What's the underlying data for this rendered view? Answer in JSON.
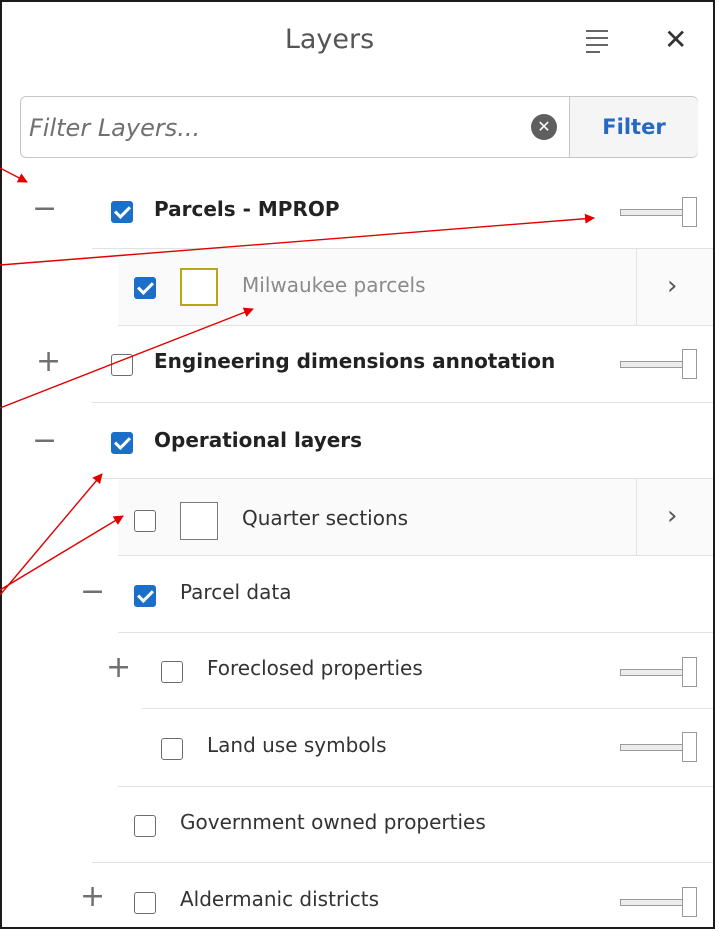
{
  "header": {
    "title": "Layers",
    "menu_icon": "list-options-icon",
    "close_icon": "close-icon",
    "close_glyph": "✕"
  },
  "filter": {
    "placeholder": "Filter Layers...",
    "value": "",
    "clear_icon": "clear-circle-icon",
    "button_label": "Filter"
  },
  "colors": {
    "accent": "#2569c3",
    "checkbox": "#1b6fc9",
    "annotation_arrow": "#e00000",
    "swatch_olive": "#b7a712"
  },
  "layers": [
    {
      "id": "parcels_mprop",
      "label": "Parcels - MPROP",
      "expander": "−",
      "checked": true,
      "bold": true,
      "slider": true
    },
    {
      "id": "milwaukee_parcels",
      "label": "Milwaukee parcels",
      "checked": true,
      "swatch": "olive",
      "greyed": true,
      "chevron": "›"
    },
    {
      "id": "engineering",
      "label": "Engineering dimensions annotation",
      "expander": "+",
      "checked": false,
      "bold": true,
      "slider": true
    },
    {
      "id": "operational",
      "label": "Operational layers",
      "expander": "−",
      "checked": true,
      "bold": true
    },
    {
      "id": "quarter_sections",
      "label": "Quarter sections",
      "checked": false,
      "swatch": "plain",
      "chevron": "›"
    },
    {
      "id": "parcel_data",
      "label": "Parcel data",
      "expander": "−",
      "checked": true
    },
    {
      "id": "foreclosed",
      "label": "Foreclosed properties",
      "expander": "+",
      "checked": false,
      "slider": true
    },
    {
      "id": "land_use",
      "label": "Land use symbols",
      "checked": false,
      "slider": true
    },
    {
      "id": "government",
      "label": "Government owned properties",
      "checked": false
    },
    {
      "id": "aldermanic",
      "label": "Aldermanic districts",
      "expander": "+",
      "checked": false,
      "slider": true
    }
  ]
}
